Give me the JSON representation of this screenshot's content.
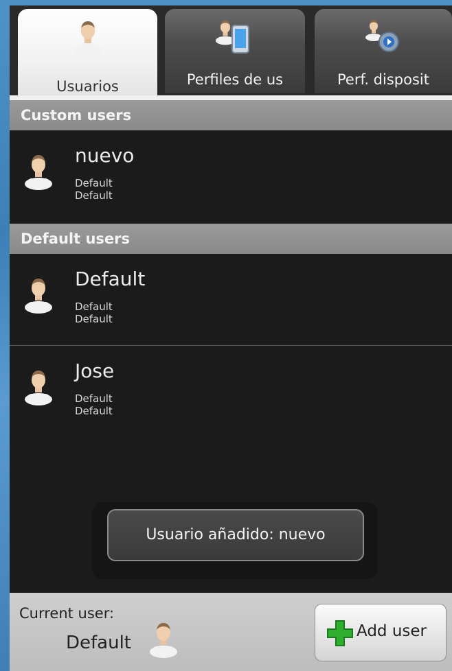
{
  "tabs": [
    {
      "label": "Usuarios",
      "icon": "user-icon",
      "active": true
    },
    {
      "label": "Perfiles de us",
      "icon": "user-phone-icon",
      "active": false
    },
    {
      "label": "Perf. disposit",
      "icon": "user-gear-icon",
      "active": false
    }
  ],
  "sections": {
    "custom": {
      "title": "Custom users",
      "items": [
        {
          "name": "nuevo",
          "line1": "Default",
          "line2": "Default"
        }
      ]
    },
    "default": {
      "title": "Default users",
      "items": [
        {
          "name": "Default",
          "line1": "Default",
          "line2": "Default"
        },
        {
          "name": "Jose",
          "line1": "Default",
          "line2": "Default"
        }
      ]
    }
  },
  "toast": {
    "message": "Usuario añadido: nuevo"
  },
  "footer": {
    "current_label": "Current user:",
    "current_name": "Default",
    "add_button_label": "Add user"
  },
  "colors": {
    "background": "#1b1b1b",
    "section_header": "#8f8f8f",
    "add_icon": "#2fae2f"
  }
}
